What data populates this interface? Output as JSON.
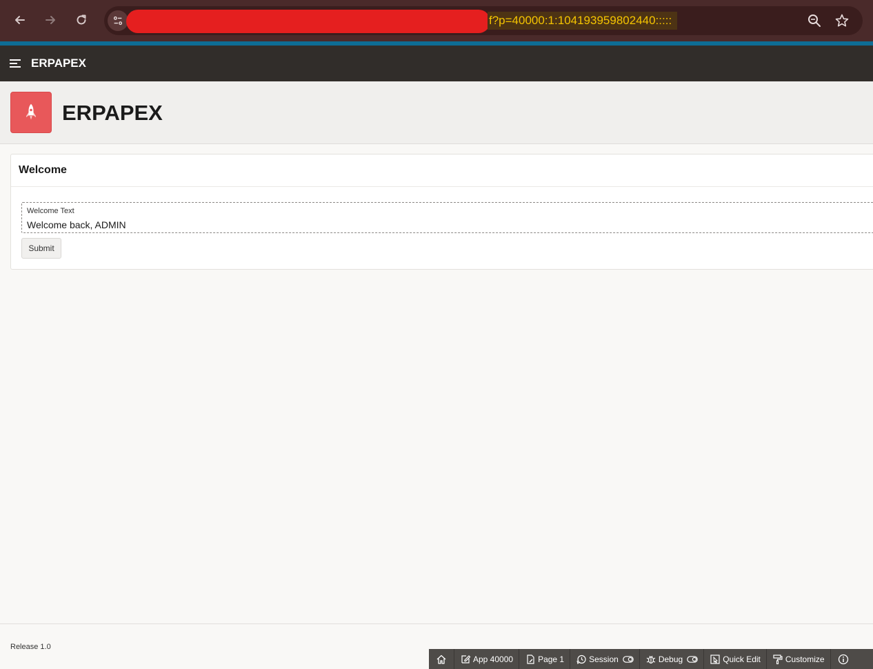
{
  "browser": {
    "url_visible_tail": "f?p=40000:1:104193959802440:::::",
    "colors": {
      "chrome": "#4a2a2a",
      "url_box": "#3a1d1d",
      "highlight_text": "#f5c400",
      "redaction": "#e51f1f"
    },
    "icons": [
      "back-arrow-icon",
      "forward-arrow-icon",
      "reload-icon",
      "site-info-icon",
      "zoom-icon",
      "bookmark-star-icon"
    ]
  },
  "header": {
    "app_name": "ERPAPEX",
    "menu_icon": "hamburger-icon"
  },
  "hero": {
    "title": "ERPAPEX",
    "icon": "rocket-icon",
    "icon_color": "#e8585a"
  },
  "region": {
    "title": "Welcome",
    "field": {
      "label": "Welcome Text",
      "value": "Welcome back, ADMIN"
    },
    "submit_label": "Submit"
  },
  "footer": {
    "release": "Release 1.0"
  },
  "dev_toolbar": {
    "home_icon": "home-icon",
    "app_label": "App 40000",
    "page_label": "Page 1",
    "session_label": "Session",
    "debug_label": "Debug",
    "quick_edit_label": "Quick Edit",
    "customize_label": "Customize",
    "info_icon": "info-icon"
  }
}
